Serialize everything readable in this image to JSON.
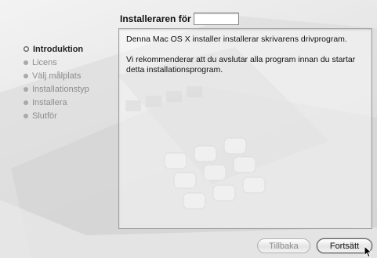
{
  "window": {
    "title_prefix": "Installeraren för"
  },
  "sidebar": {
    "steps": [
      {
        "label": "Introduktion",
        "state": "active"
      },
      {
        "label": "Licens",
        "state": "inactive"
      },
      {
        "label": "Välj målplats",
        "state": "inactive"
      },
      {
        "label": "Installationstyp",
        "state": "inactive"
      },
      {
        "label": "Installera",
        "state": "inactive"
      },
      {
        "label": "Slutför",
        "state": "inactive"
      }
    ]
  },
  "content": {
    "paragraph_1": "Denna Mac OS X installer installerar skrivarens drivprogram.",
    "paragraph_2": "Vi rekommenderar att du avslutar alla program innan du startar detta installationsprogram."
  },
  "footer": {
    "back_label": "Tillbaka",
    "back_enabled": false,
    "continue_label": "Fortsätt"
  },
  "icons": [
    "step-bullet-icon",
    "pointer-cursor-icon"
  ]
}
